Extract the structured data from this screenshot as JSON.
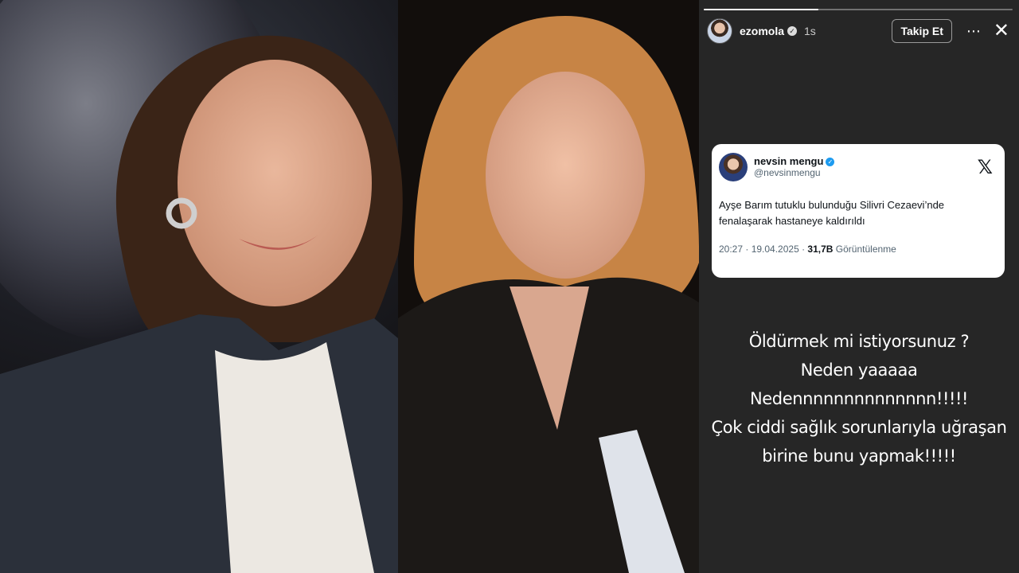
{
  "story": {
    "progress": 0.37,
    "username": "ezomola",
    "verified_badge": "verified-icon",
    "time": "1s",
    "follow_label": "Takip Et",
    "more_icon": "⋯",
    "close_icon": "✕"
  },
  "tweet": {
    "name": "nevsin mengu",
    "handle": "@nevsinmengu",
    "logo": "𝕏",
    "text": "Ayşe Barım tutuklu bulunduğu Silivri Cezaevi’nde fenalaşarak hastaneye kaldırıldı",
    "time": "20:27 · 19.04.2025 · ",
    "views_count": "31,7B",
    "views_label": " Görüntülenme"
  },
  "caption": {
    "lines": [
      "Öldürmek mi istiyorsunuz ?",
      "Neden yaaaaa",
      "Nedennnnnnnnnnnnnn!!!!!",
      "Çok ciddi sağlık sorunlarıyla uğraşan",
      "birine bunu yapmak!!!!!"
    ]
  },
  "colors": {
    "panel_bg": "#262626",
    "verified_blue": "#1d9bf0"
  }
}
